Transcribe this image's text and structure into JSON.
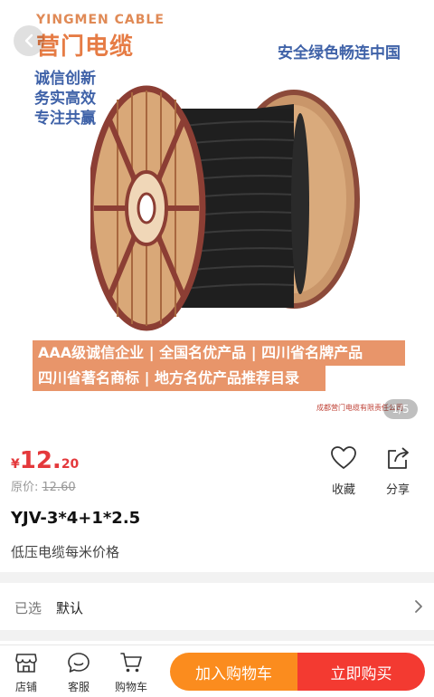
{
  "hero": {
    "brand_en": "YINGMEN CABLE",
    "brand_cn": "营门电缆",
    "tagline": "安全绿色畅连中国",
    "slogans": [
      "诚信创新",
      "务实高效",
      "专注共赢"
    ],
    "honors_row1": "AAA级诚信企业 | 全国名优产品 | 四川省名牌产品",
    "honors_row2": "四川省著名商标 | 地方名优产品推荐目录",
    "company_note": "成都营门电缆有限责任公司",
    "pager": "1/5"
  },
  "price": {
    "symbol": "¥",
    "integer": "12.",
    "decimal": "20",
    "original_label": "原价:",
    "original_value": "12.60"
  },
  "actions": {
    "favorite_label": "收藏",
    "share_label": "分享"
  },
  "product": {
    "title": "YJV-3*4+1*2.5",
    "subtitle": "低压电缆每米价格"
  },
  "selection": {
    "label": "已选",
    "value": "默认"
  },
  "bottom_bar": {
    "store_label": "店铺",
    "service_label": "客服",
    "cart_label": "购物车",
    "add_to_cart": "加入购物车",
    "buy_now": "立即购买"
  },
  "colors": {
    "price_red": "#e4393c",
    "cart_orange": "#fb8c1e",
    "buy_red": "#f33a31",
    "slogan_blue": "#3f62a8",
    "brand_orange": "#e67c45"
  },
  "icons": {
    "back": "chevron-left-icon",
    "favorite": "heart-icon",
    "share": "share-icon",
    "store": "store-icon",
    "service": "chat-icon",
    "cart": "cart-icon",
    "chevron": "chevron-right-icon"
  }
}
